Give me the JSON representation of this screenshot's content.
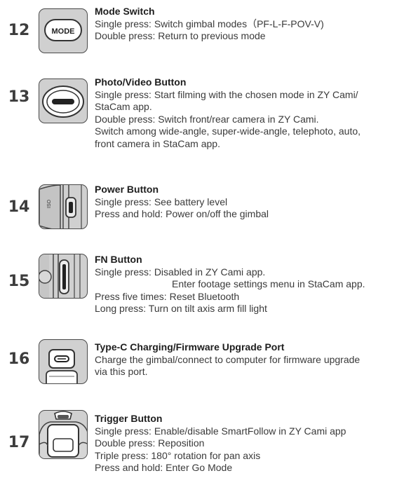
{
  "entries": [
    {
      "number": "12",
      "title": "Mode Switch",
      "icon_label": "MODE",
      "lines": [
        "Single press: Switch gimbal modes（PF-L-F-POV-V)",
        "Double press: Return to previous mode"
      ]
    },
    {
      "number": "13",
      "title": "Photo/Video Button",
      "lines": [
        "Single press: Start filming with the chosen mode in ZY Cami/",
        "StaCam app.",
        "Double press: Switch front/rear camera in ZY Cami.",
        "Switch among wide-angle, super-wide-angle, telephoto, auto,",
        "front camera in StaCam app."
      ]
    },
    {
      "number": "14",
      "title": "Power Button",
      "icon_label": "ISO",
      "lines": [
        "Single press: See battery level",
        "Press and hold: Power on/off the gimbal"
      ]
    },
    {
      "number": "15",
      "title": "FN Button",
      "lines": [
        "Single press: Disabled in ZY Cami app.",
        "Enter footage settings menu in StaCam app.",
        "Press five times: Reset Bluetooth",
        "Long press: Turn on tilt axis arm fill light"
      ]
    },
    {
      "number": "16",
      "title": "Type-C Charging/Firmware Upgrade Port",
      "lines": [
        "Charge the gimbal/connect to computer for firmware upgrade",
        "via this port."
      ]
    },
    {
      "number": "17",
      "title": "Trigger Button",
      "lines": [
        "Single press: Enable/disable SmartFollow in ZY Cami app",
        "Double press: Reposition",
        "Triple press: 180° rotation for pan axis",
        "Press and hold: Enter Go Mode"
      ]
    }
  ]
}
